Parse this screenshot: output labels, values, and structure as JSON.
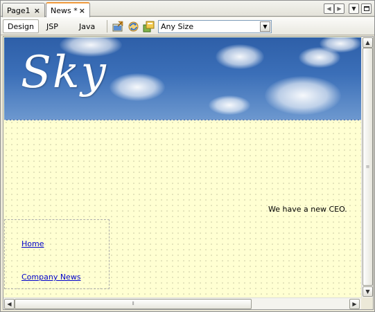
{
  "tabs": [
    {
      "label": "Page1",
      "active": false
    },
    {
      "label": "News *",
      "active": true
    }
  ],
  "tab_close_glyph": "×",
  "tab_controls": [
    "scroll-left-icon",
    "scroll-right-icon",
    "dropdown-icon",
    "maximize-icon"
  ],
  "toolbar": {
    "views": [
      "Design",
      "JSP",
      "Java"
    ],
    "selected_view": "Design",
    "icons": [
      "preview-in-browser-icon",
      "refresh-icon",
      "show-virtual-forms-icon"
    ],
    "size_select": {
      "value": "Any Size"
    }
  },
  "page": {
    "banner_text": "Sky",
    "news_text": "We have a new CEO.",
    "nav_links": [
      "Home",
      "Company News"
    ]
  },
  "colors": {
    "canvas_bg": "#ffffd2",
    "banner_sky": "#3b6fb8",
    "active_tab_accent": "#f09a3c",
    "link": "#0000cc"
  }
}
